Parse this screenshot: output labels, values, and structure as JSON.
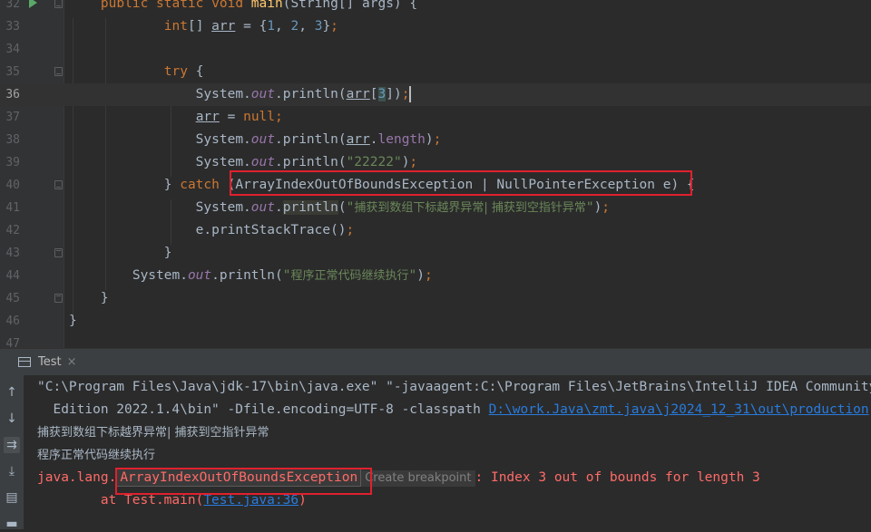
{
  "editor": {
    "lines": [
      {
        "n": "32",
        "current": false,
        "run_icon": true,
        "fold": "top",
        "html": "    <span class='kw'>public static void </span><span class='fn'>main</span>(String[] args) {"
      },
      {
        "n": "33",
        "current": false,
        "run_icon": false,
        "fold": "",
        "html": "            <span class='kw'>int</span>[] <span class='ul'>arr</span> = {<span class='num'>1</span>, <span class='num'>2</span>, <span class='num'>3</span>}<span class='kw'>;</span>"
      },
      {
        "n": "34",
        "current": false,
        "run_icon": false,
        "fold": "",
        "html": ""
      },
      {
        "n": "35",
        "current": false,
        "run_icon": false,
        "fold": "top",
        "html": "            <span class='kw'>try </span>{"
      },
      {
        "n": "36",
        "current": true,
        "run_icon": false,
        "fold": "",
        "html": "                System.<span class='stat'>out</span>.println(<span class='ul'>arr</span>[<span class='num hl-arr'>3</span>])<span class='kw'>;</span><span class='caret'></span>"
      },
      {
        "n": "37",
        "current": false,
        "run_icon": false,
        "fold": "",
        "html": "                <span class='ul'>arr</span> = <span class='kw'>null;</span>"
      },
      {
        "n": "38",
        "current": false,
        "run_icon": false,
        "fold": "",
        "html": "                System.<span class='stat'>out</span>.println(<span class='ul'>arr</span>.<span class='fld'>length</span>)<span class='kw'>;</span>"
      },
      {
        "n": "39",
        "current": false,
        "run_icon": false,
        "fold": "",
        "html": "                System.<span class='stat'>out</span>.println(<span class='str'>\"22222\"</span>)<span class='kw'>;</span>"
      },
      {
        "n": "40",
        "current": false,
        "run_icon": false,
        "fold": "top",
        "html": "            } <span class='kw'>catch </span>(ArrayIndexOutOfBoundsException | NullPointerException e) {"
      },
      {
        "n": "41",
        "current": false,
        "run_icon": false,
        "fold": "",
        "html": "                System.<span class='stat'>out</span>.<span class='hl-pl'>println</span>(<span class='str'>\"<span class='cn'>捕获到数组下标越界异常| 捕获到空指针异常</span>\"</span>)<span class='kw'>;</span>"
      },
      {
        "n": "42",
        "current": false,
        "run_icon": false,
        "fold": "",
        "html": "                e.printStackTrace()<span class='kw'>;</span>"
      },
      {
        "n": "43",
        "current": false,
        "run_icon": false,
        "fold": "bot",
        "html": "            }"
      },
      {
        "n": "44",
        "current": false,
        "run_icon": false,
        "fold": "",
        "html": "        System.<span class='stat'>out</span>.println(<span class='str'>\"<span class='cn'>程序正常代码继续执行</span>\"</span>)<span class='kw'>;</span>"
      },
      {
        "n": "45",
        "current": false,
        "run_icon": false,
        "fold": "bot",
        "html": "    }"
      },
      {
        "n": "46",
        "current": false,
        "run_icon": false,
        "fold": "",
        "html": "}"
      },
      {
        "n": "47",
        "current": false,
        "run_icon": false,
        "fold": "",
        "html": ""
      }
    ]
  },
  "run_panel": {
    "tab_label": "Test",
    "tab_close": "×",
    "toolbar_icons": [
      "arrow-up-icon",
      "arrow-down-icon",
      "soft-wrap-icon",
      "scroll-to-end-icon",
      "print-icon",
      "trash-icon"
    ],
    "console": {
      "cmd_line1": "\"C:\\Program Files\\Java\\jdk-17\\bin\\java.exe\" \"-javaagent:C:\\Program Files\\JetBrains\\IntelliJ IDEA Community",
      "cmd_line2_prefix": "  Edition 2022.1.4\\bin\" -Dfile.encoding=UTF-8 -classpath ",
      "cmd_line2_link": "D:\\work.Java\\zmt.java\\j2024_12_31\\out\\production",
      "output1": "捕获到数组下标越界异常| 捕获到空指针异常",
      "output2": "程序正常代码继续执行",
      "err_prefix": "java.lang.",
      "err_exception": "ArrayIndexOutOfBoundsException",
      "create_breakpoint": "Create breakpoint",
      "err_suffix": ": Index 3 out of bounds for length 3",
      "trace_prefix": "        at Test.main(",
      "trace_link": "Test.java:36",
      "trace_suffix": ")"
    }
  },
  "colors": {
    "keyword": "#cc7832",
    "method": "#ffc66d",
    "number": "#6897bb",
    "string": "#6a8759",
    "error": "#ff6b68",
    "link": "#287bde",
    "annotation_box": "#e0202e"
  }
}
